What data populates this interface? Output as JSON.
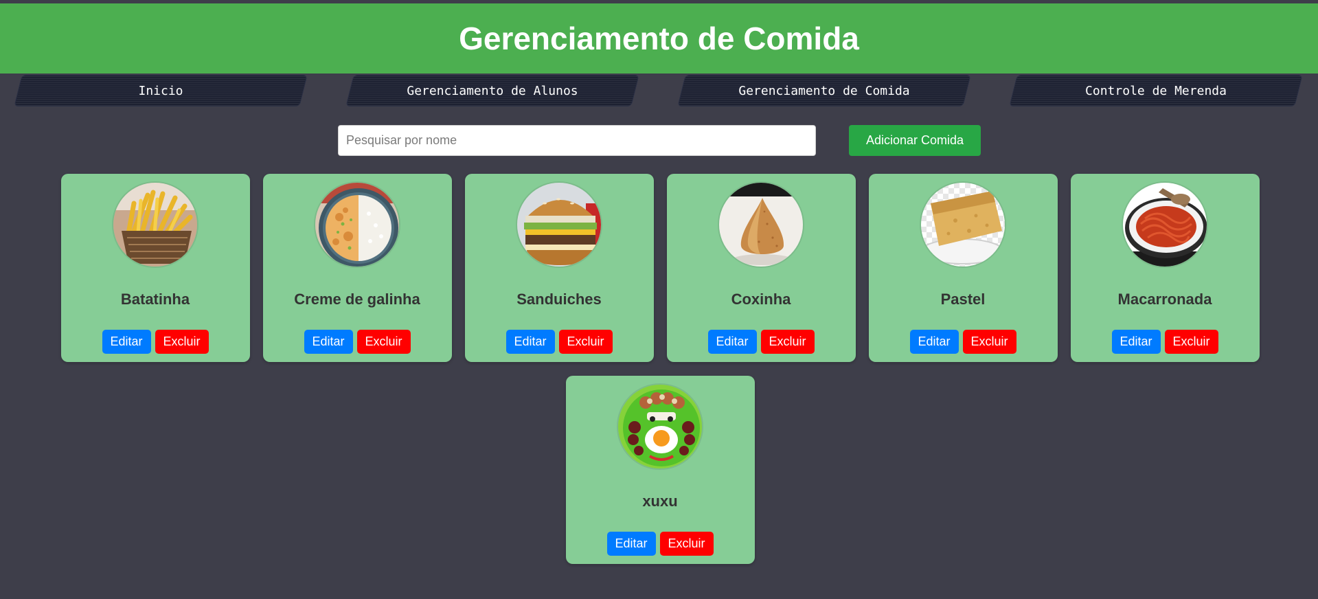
{
  "header": {
    "title": "Gerenciamento de Comida"
  },
  "nav": {
    "items": [
      {
        "label": "Inicio"
      },
      {
        "label": "Gerenciamento de Alunos"
      },
      {
        "label": "Gerenciamento de Comida"
      },
      {
        "label": "Controle de Merenda"
      }
    ]
  },
  "search": {
    "placeholder": "Pesquisar por nome",
    "value": ""
  },
  "add_button": {
    "label": "Adicionar Comida"
  },
  "foods": [
    {
      "name": "Batatinha",
      "image": "fries-image",
      "edit_label": "Editar",
      "delete_label": "Excluir"
    },
    {
      "name": "Creme de galinha",
      "image": "chicken-cream-image",
      "edit_label": "Editar",
      "delete_label": "Excluir"
    },
    {
      "name": "Sanduiches",
      "image": "sandwich-image",
      "edit_label": "Editar",
      "delete_label": "Excluir"
    },
    {
      "name": "Coxinha",
      "image": "coxinha-image",
      "edit_label": "Editar",
      "delete_label": "Excluir"
    },
    {
      "name": "Pastel",
      "image": "pastel-image",
      "edit_label": "Editar",
      "delete_label": "Excluir"
    },
    {
      "name": "Macarronada",
      "image": "spaghetti-image",
      "edit_label": "Editar",
      "delete_label": "Excluir"
    },
    {
      "name": "xuxu",
      "image": "clown-plate-image",
      "edit_label": "Editar",
      "delete_label": "Excluir"
    }
  ],
  "colors": {
    "header": "#4caf50",
    "background": "#3e3e4a",
    "card": "#86cd96",
    "add_button": "#28a745",
    "edit_button": "#007bff",
    "delete_button": "#ff0000"
  }
}
